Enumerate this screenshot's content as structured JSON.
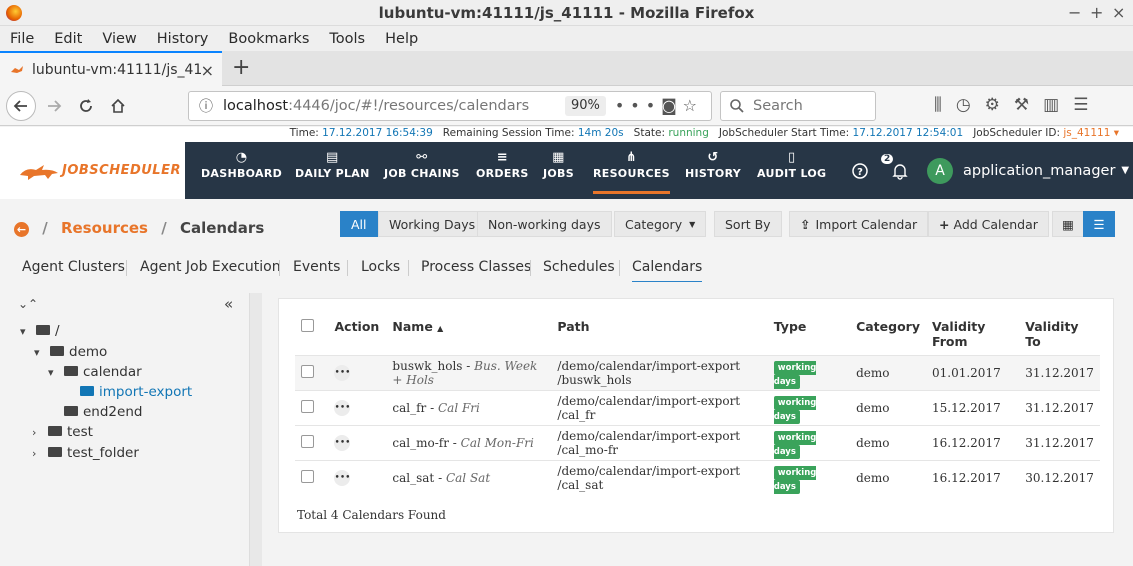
{
  "window": {
    "title": "lubuntu-vm:41111/js_41111 - Mozilla Firefox",
    "controls": [
      "−",
      "+",
      "×"
    ]
  },
  "menu": [
    "File",
    "Edit",
    "View",
    "History",
    "Bookmarks",
    "Tools",
    "Help"
  ],
  "tab": {
    "label": "lubuntu-vm:41111/js_41",
    "close": "×",
    "new": "+"
  },
  "nav": {
    "url_host": "localhost",
    "url_rest": ":4446/joc/#!/resources/calendars",
    "zoom": "90%",
    "search_placeholder": "Search"
  },
  "info": {
    "time_label": "Time:",
    "time": "17.12.2017 16:54:39",
    "session_label": "Remaining Session Time:",
    "session": "14m 20s",
    "state_label": "State:",
    "state": "running",
    "start_label": "JobScheduler Start Time:",
    "start": "17.12.2017 12:54:01",
    "id_label": "JobScheduler ID:",
    "id": "js_41111 ▾"
  },
  "header": {
    "logo": "JOBSCHEDULER",
    "nav": [
      "DASHBOARD",
      "DAILY PLAN",
      "JOB CHAINS",
      "ORDERS",
      "JOBS",
      "RESOURCES",
      "HISTORY",
      "AUDIT LOG"
    ],
    "notif_count": "2",
    "avatar": "A",
    "user": "application_manager"
  },
  "breadcrumb": {
    "home": "←",
    "resources": "Resources",
    "calendars": "Calendars"
  },
  "filters": {
    "all": "All",
    "working": "Working Days",
    "nonworking": "Non-working days",
    "category": "Category",
    "sortby": "Sort By",
    "import": "Import Calendar",
    "add": "Add Calendar"
  },
  "subtabs": [
    "Agent Clusters",
    "Agent Job Execution",
    "Events",
    "Locks",
    "Process Classes",
    "Schedules",
    "Calendars"
  ],
  "tree": {
    "root": "/",
    "demo": "demo",
    "calendar": "calendar",
    "import_export": "import-export",
    "end2end": "end2end",
    "test": "test",
    "test_folder": "test_folder"
  },
  "table": {
    "headers": {
      "action": "Action",
      "name": "Name",
      "path": "Path",
      "type": "Type",
      "category": "Category",
      "vfrom": "Validity From",
      "vto": "Validity To"
    },
    "rows": [
      {
        "name": "buswk_hols",
        "desc": "Bus. Week + Hols",
        "path1": "/demo/calendar/import-export",
        "path2": "/buswk_hols",
        "type": "working days",
        "category": "demo",
        "from": "01.01.2017",
        "to": "31.12.2017"
      },
      {
        "name": "cal_fr",
        "desc": "Cal Fri",
        "path1": "/demo/calendar/import-export",
        "path2": "/cal_fr",
        "type": "working days",
        "category": "demo",
        "from": "15.12.2017",
        "to": "31.12.2017"
      },
      {
        "name": "cal_mo-fr",
        "desc": "Cal Mon-Fri",
        "path1": "/demo/calendar/import-export",
        "path2": "/cal_mo-fr",
        "type": "working days",
        "category": "demo",
        "from": "16.12.2017",
        "to": "31.12.2017"
      },
      {
        "name": "cal_sat",
        "desc": "Cal Sat",
        "path1": "/demo/calendar/import-export",
        "path2": "/cal_sat",
        "type": "working days",
        "category": "demo",
        "from": "16.12.2017",
        "to": "30.12.2017"
      }
    ],
    "total": "Total 4 Calendars Found"
  }
}
